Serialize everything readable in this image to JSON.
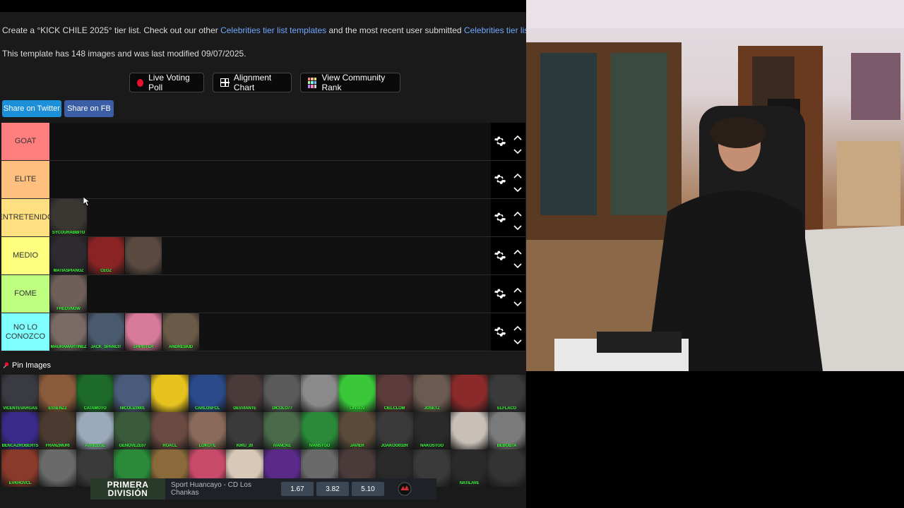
{
  "description_line": {
    "prefix": "Create a °KICK CHILE 2025° tier list. Check out our other ",
    "link1": "Celebrities tier list templates",
    "middle": " and the most recent user submitted ",
    "link2": "Celebrities tier lists",
    "suffix": "."
  },
  "template_info": "This template has 148 images and was last modified 09/07/2025.",
  "toolbar": {
    "poll_label": "Live Voting Poll",
    "alignment_label": "Alignment Chart",
    "community_label": "View Community Rank"
  },
  "share": {
    "twitter": "Share on Twitter",
    "fb": "Share on FB"
  },
  "colors": {
    "accent_red": "#e8112d",
    "twitter_blue": "#1c8fd9",
    "fb_blue": "#3b5ea6",
    "link_blue": "#6fa8ff",
    "caption_green": "#3cff3c"
  },
  "tiers": [
    {
      "label": "GOAT",
      "color": "#ff7f7f",
      "items": []
    },
    {
      "label": "ELITE",
      "color": "#ffbf7f",
      "items": []
    },
    {
      "label": "ENTRETENIDO",
      "color": "#ffdf7f",
      "items": [
        {
          "caption": "SYCOURABBITO",
          "color": "#3a3632"
        }
      ]
    },
    {
      "label": "MEDIO",
      "color": "#ffff7f",
      "items": [
        {
          "caption": "MATIASPIANOZ",
          "color": "#2d2a30"
        },
        {
          "caption": "CEOZ",
          "color": "#8a2424"
        },
        {
          "caption": "",
          "color": "#5a4a40"
        }
      ]
    },
    {
      "label": "FOME",
      "color": "#bfff7f",
      "items": [
        {
          "caption": "FREDVNOW",
          "color": "#6e6058"
        }
      ]
    },
    {
      "label": "NO LO CONOZCO",
      "color": "#7fffff",
      "items": [
        {
          "caption": "MAURAMARTINEZ",
          "color": "#7a6a66"
        },
        {
          "caption": "JACK_SPANCIT",
          "color": "#4a5a6e"
        },
        {
          "caption": "SHPISTER",
          "color": "#d87a9a"
        },
        {
          "caption": "ANDRESKID",
          "color": "#6a5a48"
        }
      ]
    }
  ],
  "pin_label": "Pin Images",
  "pool": [
    {
      "caption": "VICENTEVARGAS",
      "color": "#3a3a42"
    },
    {
      "caption": "ESSENZZ",
      "color": "#8a5a3a"
    },
    {
      "caption": "CATAMOTO",
      "color": "#1e6a2a"
    },
    {
      "caption": "NICOLIZ0001",
      "color": "#4a5a7a"
    },
    {
      "caption": "",
      "color": "#e6c21e"
    },
    {
      "caption": "CARLOSFCL",
      "color": "#2a4a8a"
    },
    {
      "caption": "DESVIANTE",
      "color": "#4a3a3a"
    },
    {
      "caption": "DICOLO77",
      "color": "#5a5a5a"
    },
    {
      "caption": "",
      "color": "#8a8a8a"
    },
    {
      "caption": "LINSEN",
      "color": "#3ac83a"
    },
    {
      "caption": "CIELCLOM",
      "color": "#5a3a3a"
    },
    {
      "caption": "JOSETZ",
      "color": "#6a5a50"
    },
    {
      "caption": "",
      "color": "#8a2a2a"
    },
    {
      "caption": "ELFLACO",
      "color": "#3a3a3a"
    },
    {
      "caption": "BENCAZROBERTS",
      "color": "#3a2a8a"
    },
    {
      "caption": "FRANZMURI",
      "color": "#4a3a30"
    },
    {
      "caption": "AVRILEGE",
      "color": "#9aaaba"
    },
    {
      "caption": "GENOVEZE07",
      "color": "#3a5a3a"
    },
    {
      "caption": "ROACL",
      "color": "#6a4a40"
    },
    {
      "caption": "LOKOTE",
      "color": "#8a6a5a"
    },
    {
      "caption": "KIRU_20",
      "color": "#3a3a3a"
    },
    {
      "caption": "IVANCKE",
      "color": "#4a6a4a"
    },
    {
      "caption": "IVANSTGO",
      "color": "#2a8a3a"
    },
    {
      "caption": "JAVIER",
      "color": "#5a4a3a"
    },
    {
      "caption": "JOAKOO032R",
      "color": "#3a3a3a"
    },
    {
      "caption": "NAKOSTGO",
      "color": "#2a2a2a"
    },
    {
      "caption": "",
      "color": "#c8c0b8"
    },
    {
      "caption": "BEBOBTA",
      "color": "#7a7a7a"
    },
    {
      "caption": "EVKHOVCL",
      "color": "#8a3a2a"
    },
    {
      "caption": "",
      "color": "#6a6a6a"
    },
    {
      "caption": "",
      "color": "#3a3a3a"
    },
    {
      "caption": "LUKMALIK",
      "color": "#2a8a3a"
    },
    {
      "caption": "",
      "color": "#8a6a3a"
    },
    {
      "caption": "",
      "color": "#c84a6a"
    },
    {
      "caption": "",
      "color": "#d8c8b8"
    },
    {
      "caption": "",
      "color": "#5a2a8a"
    },
    {
      "caption": "",
      "color": "#6a6a6a"
    },
    {
      "caption": "",
      "color": "#4a3a3a"
    },
    {
      "caption": "",
      "color": "#2a2a2a"
    },
    {
      "caption": "",
      "color": "#3a3a3a"
    },
    {
      "caption": "NATILAVE",
      "color": "#2a2a2a"
    },
    {
      "caption": "",
      "color": "#333333"
    }
  ],
  "banner": {
    "league": "PRIMERA DIVISIÓN",
    "match": "Sport Huancayo - CD Los Chankas",
    "odds": [
      "1.67",
      "3.82",
      "5.10"
    ]
  }
}
